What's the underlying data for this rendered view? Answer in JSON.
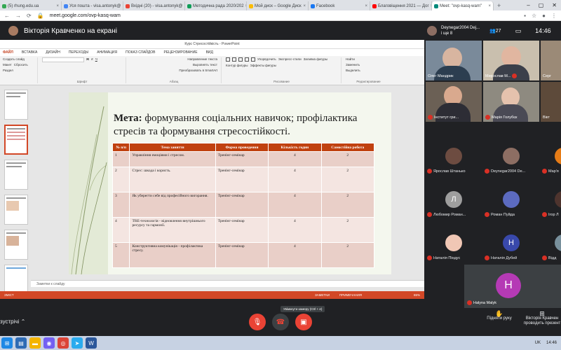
{
  "browser": {
    "tabs": [
      {
        "label": "(5) rhung.edu.ua",
        "color": "#34a853"
      },
      {
        "label": "Уся пошта - visa.antonyk@",
        "color": "#4285f4"
      },
      {
        "label": "Вхідні (20) - visa.antonyk@",
        "color": "#ea4335"
      },
      {
        "label": "Методична рада 2020/202",
        "color": "#0f9d58"
      },
      {
        "label": "Мой диск – Google Диск",
        "color": "#fbbc04"
      },
      {
        "label": "Facebook",
        "color": "#1877f2"
      },
      {
        "label": "Благовіщення 2021 — Дог",
        "color": "#ff0000"
      },
      {
        "label": "Meet: \"ovp-kasq-wam\"",
        "color": "#00897b"
      }
    ],
    "new_tab": "+",
    "url": "meet.google.com/ovp-kasq-wam"
  },
  "meet": {
    "presenter_title": "Вікторія Кравченко на екрані",
    "host_name": "Deynegar2004 Dej...",
    "host_sub": "і ще 8",
    "participant_count": "27",
    "time": "14:46",
    "tooltip": "Увімкнути камеру (Ctrl + e)",
    "left_text": "зустрічі",
    "raise_hand": "Підняти руку",
    "presenting": "Вікторія Кравчен проводить презент",
    "self_name": "Halyna Malyk",
    "self_initial": "Н",
    "video_tiles": [
      {
        "name": "Олег Мандрик"
      },
      {
        "name": "Мирослав М..."
      },
      {
        "name": "Серг"
      },
      {
        "name": "Інститут гри..."
      },
      {
        "name": "Марія Голубєк"
      },
      {
        "name": "Вікт"
      }
    ],
    "participants": [
      {
        "name": "Ярослав Штанько",
        "initial": ""
      },
      {
        "name": "Deynegar2004 De...",
        "initial": ""
      },
      {
        "name": "Мар'я",
        "initial": ""
      },
      {
        "name": "Любомир Роман...",
        "initial": "Л"
      },
      {
        "name": "Роман Пуйда",
        "initial": ""
      },
      {
        "name": "Ігор Л",
        "initial": ""
      },
      {
        "name": "Наталія Піндус",
        "initial": ""
      },
      {
        "name": "Наталія Дубей",
        "initial": "Н"
      },
      {
        "name": "Відд",
        "initial": ""
      }
    ]
  },
  "powerpoint": {
    "window_title": "Курс Стресостійкість - PowerPoint",
    "ribbon_tabs": [
      "ФАЙЛ",
      "ВСТАВКА",
      "ДИЗАЙН",
      "ПЕРЕХОДЫ",
      "АНИМАЦИЯ",
      "ПОКАЗ СЛАЙДОВ",
      "РЕЦЕНЗИРОВАНИЕ",
      "ВИД"
    ],
    "ribbon_items": {
      "slides": [
        "Макет",
        "Сбросить",
        "Раздел"
      ],
      "create": "Создать слайд",
      "font": "Шрифт",
      "para_items": [
        "Направление текста",
        "Выровнять текст",
        "Преобразовать в SmartArt"
      ],
      "para": "Абзац",
      "arrange": "Упорядочить",
      "quick": "Экспресс-стили",
      "fill_items": [
        "Заливка фигуры",
        "Контур фигуры",
        "Эффекты фигуры"
      ],
      "drawing": "Рисование",
      "edit_items": [
        "Найти",
        "Заменить",
        "Выделить"
      ],
      "editing": "Редактирование"
    },
    "notes": "Заметки к слайду",
    "status_left": "ЗМІСТ",
    "status_items": [
      "ЗАМЕТКИ",
      "ПРИМЕЧАНИЯ"
    ],
    "zoom": "65%"
  },
  "slide": {
    "title_bold": "Мета:",
    "title_rest": " формування соціальних навичок; профілактика стресів та формування стресостійкості.",
    "headers": [
      "№ п/п",
      "Тема заняття",
      "Форма проведення",
      "Кількість годин",
      "Самостійна робота"
    ],
    "rows": [
      [
        "1",
        "Управління емоціями і стресом.",
        "Тренінг-семінар",
        "4",
        "2"
      ],
      [
        "2",
        "Стрес: шкода і користь.",
        "Тренінг-семінар",
        "4",
        "2"
      ],
      [
        "3",
        "Як уберегти себе від професійного вигорання.",
        "Тренінг-семінар",
        "4",
        "2"
      ],
      [
        "4",
        "TRE-технологія - відновлення внутрішнього ресурсу та гармонії.",
        "Тренінг-семінар",
        "4",
        "2"
      ],
      [
        "5",
        "Конструктивна комунікація - профілактика стресу.",
        "Тренінг-семінар",
        "4",
        "2"
      ]
    ]
  },
  "taskbar": {
    "lang": "UK",
    "clock": "14:46"
  }
}
